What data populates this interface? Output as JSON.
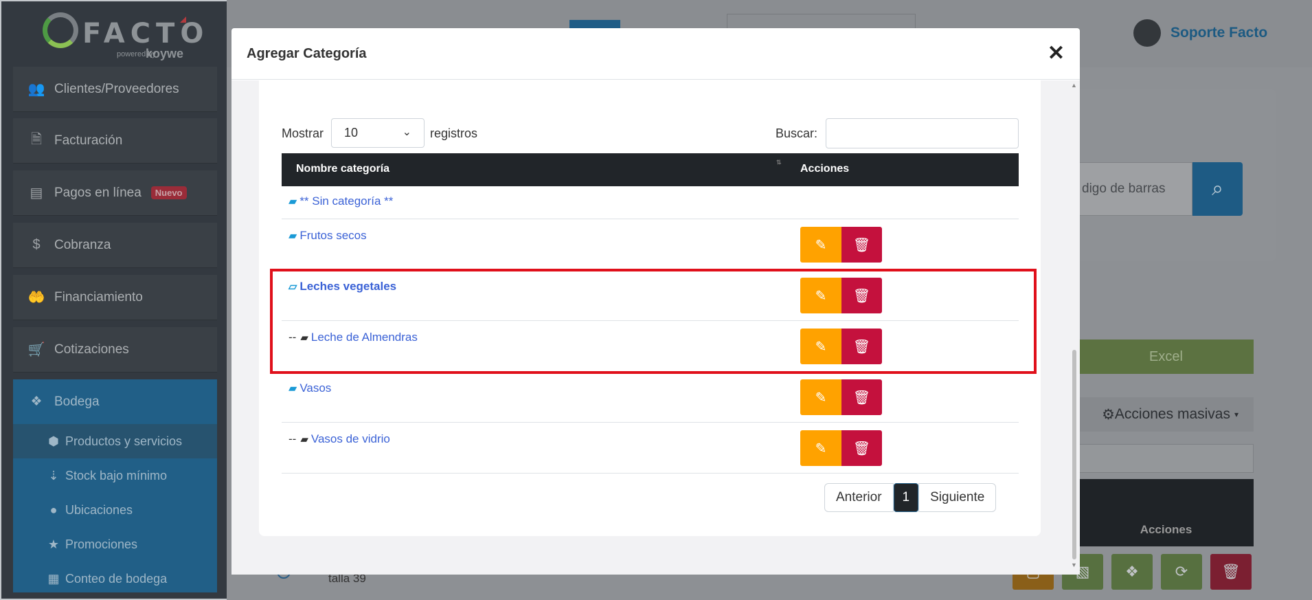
{
  "sidebar": {
    "logo_text": "FACTO",
    "logo_powered": "powered by",
    "logo_brand": "koywe",
    "items": [
      {
        "label": "Clientes/Proveedores",
        "icon": "users-icon"
      },
      {
        "label": "Facturación",
        "icon": "file-icon"
      },
      {
        "label": "Pagos en línea",
        "icon": "money-card-icon",
        "badge": "Nuevo"
      },
      {
        "label": "Cobranza",
        "icon": "dollar-icon"
      },
      {
        "label": "Financiamiento",
        "icon": "hand-money-icon"
      },
      {
        "label": "Cotizaciones",
        "icon": "cart-icon"
      }
    ],
    "bodega": {
      "label": "Bodega",
      "icon": "boxes-icon",
      "sub_items": [
        {
          "label": "Productos y servicios",
          "icon": "box-icon",
          "active": true
        },
        {
          "label": "Stock bajo mínimo",
          "icon": "sort-down-icon"
        },
        {
          "label": "Ubicaciones",
          "icon": "map-pin-icon"
        },
        {
          "label": "Promociones",
          "icon": "star-icon"
        },
        {
          "label": "Conteo de bodega",
          "icon": "calculator-icon"
        }
      ]
    }
  },
  "header": {
    "user_name": "Soporte Facto"
  },
  "background": {
    "search_placeholder": "digo de barras",
    "excel_label": "Excel",
    "bulk_actions_label": "Acciones masivas",
    "table_actions_header": "Acciones",
    "row_text": "talla 39"
  },
  "modal": {
    "title": "Agregar Categoría",
    "show_label": "Mostrar",
    "page_size": "10",
    "records_label": "registros",
    "search_label": "Buscar:",
    "search_value": "",
    "columns": [
      "Nombre categoría",
      "Acciones"
    ],
    "rows": [
      {
        "name": "** Sin categoría **",
        "prefix": "",
        "folder": "open",
        "has_actions": false,
        "bold": false
      },
      {
        "name": "Frutos secos",
        "prefix": "",
        "folder": "closed",
        "has_actions": true,
        "bold": false
      },
      {
        "name": "Leches vegetales",
        "prefix": "",
        "folder": "open",
        "has_actions": true,
        "bold": true
      },
      {
        "name": "Leche de Almendras",
        "prefix": "--",
        "folder": "dark",
        "has_actions": true,
        "bold": false
      },
      {
        "name": "Vasos",
        "prefix": "",
        "folder": "closed",
        "has_actions": true,
        "bold": false
      },
      {
        "name": "Vasos de vidrio",
        "prefix": "--",
        "folder": "dark",
        "has_actions": true,
        "bold": false
      }
    ],
    "pagination": {
      "prev": "Anterior",
      "current": "1",
      "next": "Siguiente"
    }
  },
  "colors": {
    "edit_button": "#ffa200",
    "delete_button": "#c4113d",
    "highlight_border": "#e0101b",
    "link": "#3b62d6"
  }
}
